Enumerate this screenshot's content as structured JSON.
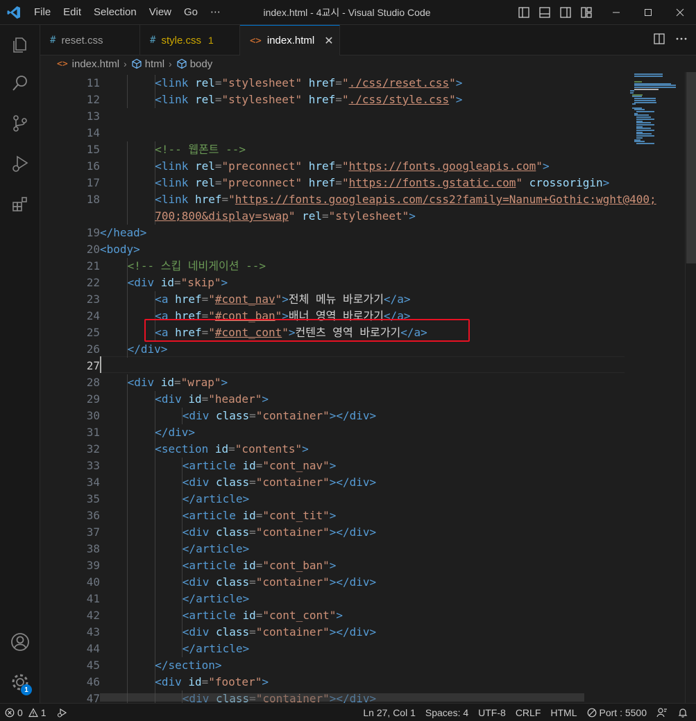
{
  "titlebar": {
    "menu": [
      "File",
      "Edit",
      "Selection",
      "View",
      "Go",
      "⋯"
    ],
    "title": "index.html - 4교시 - Visual Studio Code"
  },
  "activity": [
    "explorer-icon",
    "search-icon",
    "source-control-icon",
    "run-debug-icon",
    "extensions-icon",
    "accounts-icon",
    "settings-gear-icon"
  ],
  "settings_badge": "1",
  "tabs": [
    {
      "icon": "#",
      "label": "reset.css",
      "modified": "",
      "active": false
    },
    {
      "icon": "#",
      "label": "style.css",
      "modified": "1",
      "active": false
    },
    {
      "icon": "<>",
      "label": "index.html",
      "modified": "",
      "active": true
    }
  ],
  "tab_close": "✕",
  "breadcrumb": [
    "index.html",
    "html",
    "body"
  ],
  "editor": {
    "current_line": 27
  },
  "status": {
    "errors": "0",
    "warnings": "1",
    "position": "Ln 27, Col 1",
    "spaces": "Spaces: 4",
    "encoding": "UTF-8",
    "eol": "CRLF",
    "language": "HTML",
    "port": "Port : 5500"
  },
  "colors": {
    "accent": "#0078d4",
    "highlight_box": "#e81123",
    "tag": "#569cd6",
    "attribute": "#9cdcfe",
    "string": "#ce9178",
    "comment": "#6a9955"
  }
}
